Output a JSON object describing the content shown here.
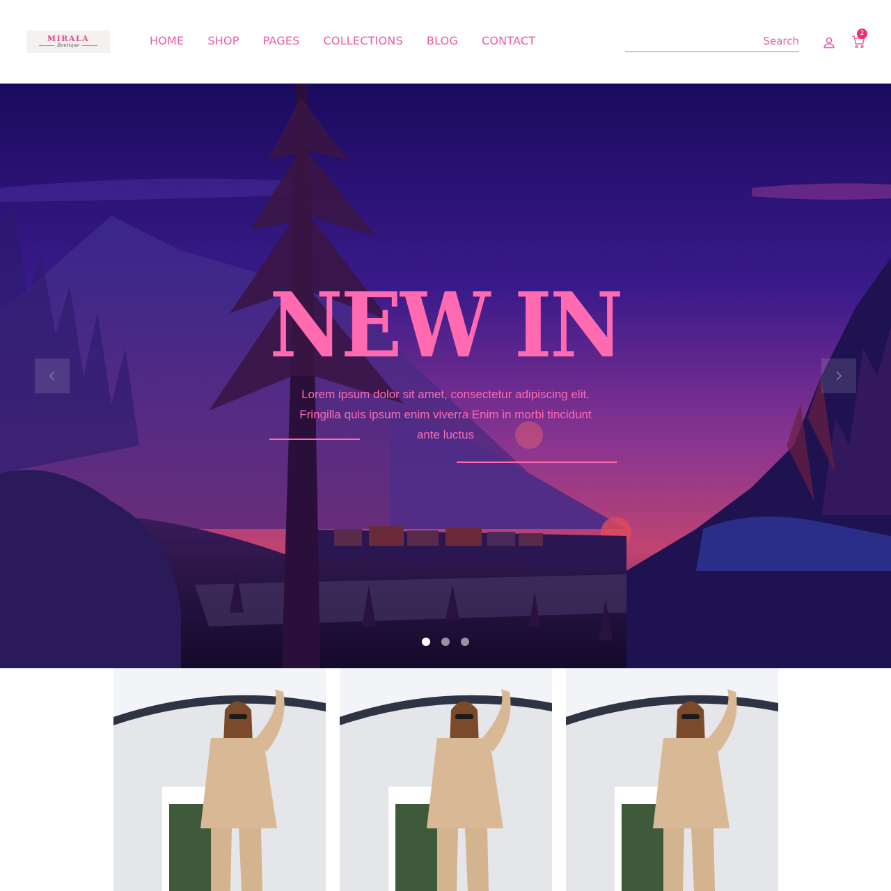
{
  "brand": {
    "name": "MIRALA",
    "tagline": "Boutique"
  },
  "nav": {
    "items": [
      "HOME",
      "SHOP",
      "PAGES",
      "COLLECTIONS",
      "BLOG",
      "CONTACT"
    ]
  },
  "search": {
    "placeholder": "Search",
    "value": ""
  },
  "header_icons": {
    "account": "user-icon",
    "cart": "cart-icon",
    "cart_count": "2"
  },
  "hero": {
    "title": "NEW IN",
    "subtitle": "Lorem ipsum dolor sit amet, consectetur adipiscing elit. Fringilla quis ipsum enim viverra Enim in morbi tincidunt ante luctus",
    "prev_icon": "chevron-left-icon",
    "next_icon": "chevron-right-icon",
    "slides_total": 3,
    "active_slide": 1
  },
  "products": [
    {
      "image": "model-beige-outfit-photo"
    },
    {
      "image": "model-beige-outfit-photo"
    },
    {
      "image": "model-beige-outfit-photo"
    }
  ],
  "colors": {
    "accent": "#ee5aa3",
    "hero_title": "#ff6ab0",
    "badge": "#ee2d6d",
    "hero_sky_top": "#1a0b5e",
    "hero_sky_bottom": "#c04470"
  }
}
